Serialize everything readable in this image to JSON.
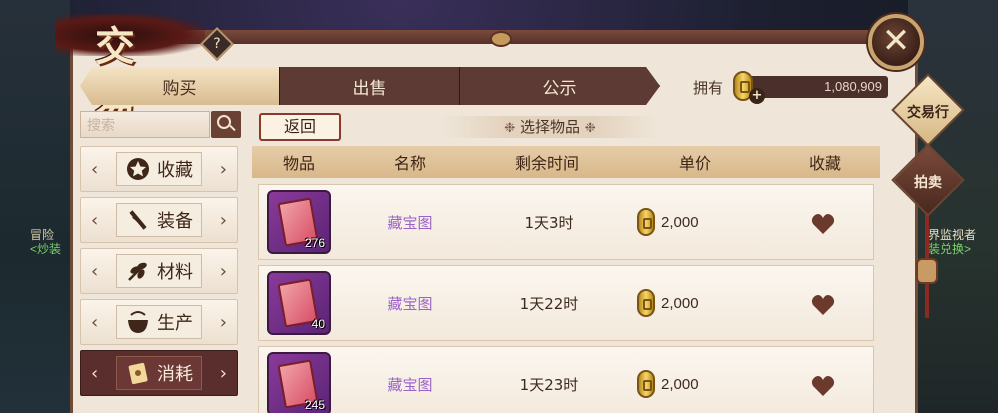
{
  "window": {
    "title": "交易",
    "help_icon": "?",
    "close_icon": "close-icon"
  },
  "tabs": [
    {
      "label": "购买",
      "active": true
    },
    {
      "label": "出售",
      "active": false
    },
    {
      "label": "公示",
      "active": false
    }
  ],
  "wallet": {
    "label": "拥有",
    "amount": "1,080,909",
    "add_symbol": "+"
  },
  "side_nav": {
    "trade_house": "交易行",
    "auction": "拍卖"
  },
  "background_text": {
    "left_line1": "冒险",
    "left_line2": "<炒装",
    "right_line1": "界监视者",
    "right_line2": "装兑换>"
  },
  "search": {
    "placeholder": "搜索"
  },
  "categories": [
    {
      "label": "收藏",
      "icon": "star-icon",
      "active": false
    },
    {
      "label": "装备",
      "icon": "weapon-icon",
      "active": false
    },
    {
      "label": "材料",
      "icon": "herb-icon",
      "active": false
    },
    {
      "label": "生产",
      "icon": "pot-icon",
      "active": false
    },
    {
      "label": "消耗",
      "icon": "scroll-icon",
      "active": true
    }
  ],
  "content": {
    "back_label": "返回",
    "section_title": "选择物品",
    "columns": [
      "物品",
      "名称",
      "剩余时间",
      "单价",
      "收藏"
    ]
  },
  "listings": [
    {
      "quantity": "276",
      "name": "藏宝图",
      "time_left": "1天3时",
      "price": "2,000",
      "icon": "treasure-map-icon"
    },
    {
      "quantity": "40",
      "name": "藏宝图",
      "time_left": "1天22时",
      "price": "2,000",
      "icon": "treasure-map-icon"
    },
    {
      "quantity": "245",
      "name": "藏宝图",
      "time_left": "1天23时",
      "price": "2,000",
      "icon": "treasure-map-icon"
    }
  ],
  "colors": {
    "accent_dark": "#5a2e2c",
    "item_name": "#9b63c9",
    "panel_bg": "#efe6d9",
    "heart": "#6b3a2c"
  }
}
